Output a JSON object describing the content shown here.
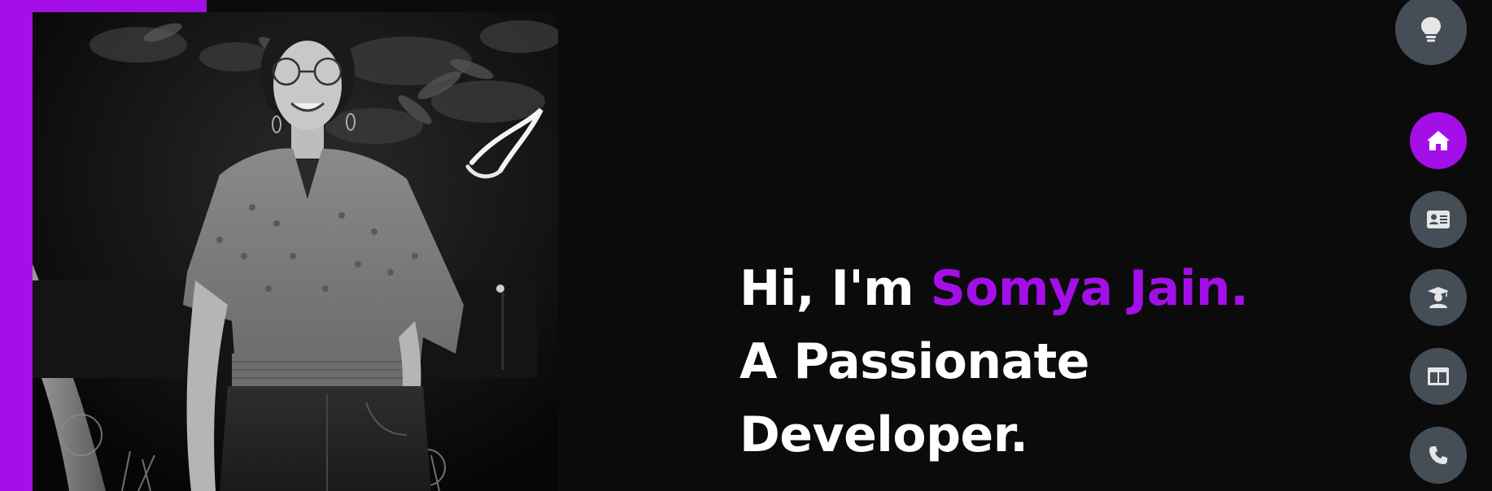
{
  "hero": {
    "greeting": "Hi, I'm ",
    "name": "Somya Jain.",
    "tagline_line1": "A Passionate",
    "tagline_line2": "Developer."
  },
  "theme_toggle": {
    "icon": "lightbulb-icon"
  },
  "nav": {
    "items": [
      {
        "icon": "home-icon",
        "active": true
      },
      {
        "icon": "id-card-icon",
        "active": false
      },
      {
        "icon": "graduate-icon",
        "active": false
      },
      {
        "icon": "portfolio-icon",
        "active": false
      },
      {
        "icon": "phone-icon",
        "active": false
      }
    ]
  },
  "colors": {
    "accent": "#a30fe6",
    "background": "#0b0b0c",
    "nav_button": "#454e57",
    "text": "#ffffff"
  }
}
